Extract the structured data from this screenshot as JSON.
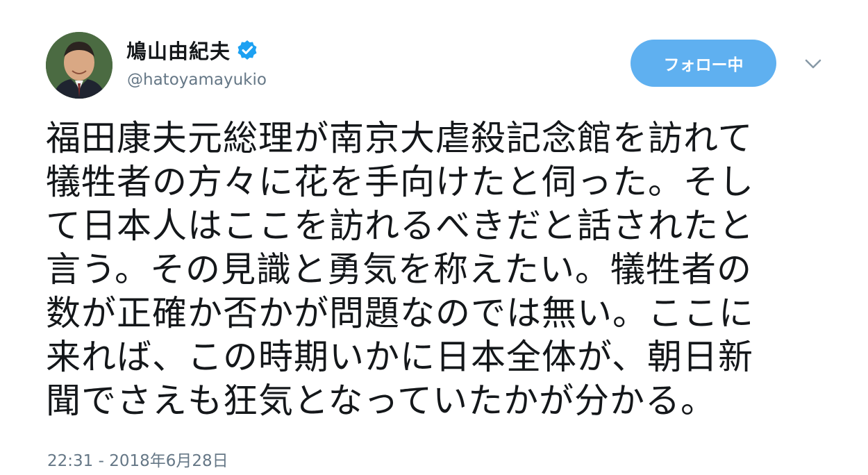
{
  "user": {
    "display_name": "鳩山由紀夫",
    "handle": "@hatoyamayukio",
    "verified": true,
    "avatar_icon": "profile-photo"
  },
  "actions": {
    "follow_label": "フォロー中",
    "menu_icon": "chevron-down-icon"
  },
  "tweet": {
    "lines": [
      "福田康夫元総理が南京大虐殺記念館を訪れて",
      "犠牲者の方々に花を手向けたと伺った。そし",
      "て日本人はここを訪れるべきだと話されたと",
      "言う。その見識と勇気を称えたい。犠牲者の",
      "数が正確か否かが問題なのでは無い。ここに",
      "来れば、この時期いかに日本全体が、朝日新",
      "聞でさえも狂気となっていたかが分かる。"
    ],
    "timestamp": "22:31 - 2018年6月28日"
  },
  "colors": {
    "accent": "#5fb0f0",
    "verified": "#1da1f2",
    "secondary_text": "#657786",
    "primary_text": "#14171a"
  }
}
